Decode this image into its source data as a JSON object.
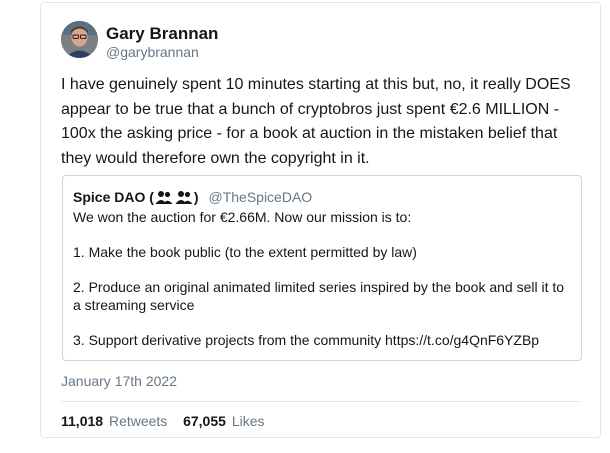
{
  "tweet": {
    "author": {
      "name": "Gary Brannan",
      "handle": "@garybrannan"
    },
    "text": "I have genuinely spent 10 minutes starting at this but, no, it really DOES appear to be true that a bunch of cryptobros just spent €2.6 MILLION - 100x the asking price - for a book at auction in the mistaken belief that they would therefore own the copyright in it.",
    "quote": {
      "name": "Spice DAO",
      "name_suffix": ")",
      "handle": "@TheSpiceDAO",
      "lines": [
        "We won the auction for €2.66M. Now our mission is to:",
        "1. Make the book public (to the extent permitted by law)",
        "2. Produce an original animated limited series inspired by the book and sell it to a streaming service",
        "3. Support derivative projects from the community https://t.co/g4QnF6YZBp"
      ]
    },
    "timestamp": "January 17th 2022",
    "stats": {
      "retweets_count": "11,018",
      "retweets_label": "Retweets",
      "likes_count": "67,055",
      "likes_label": "Likes"
    }
  }
}
